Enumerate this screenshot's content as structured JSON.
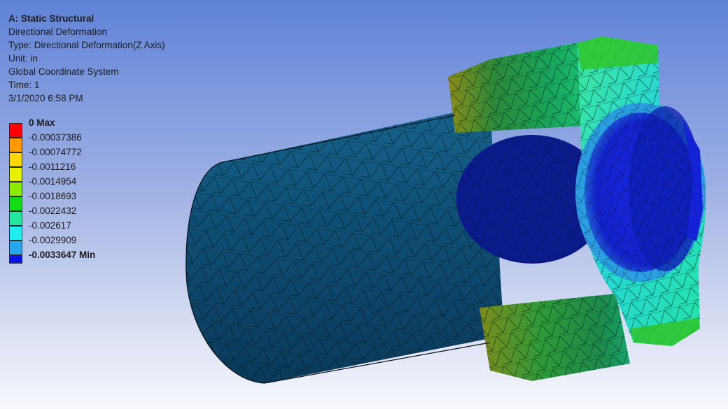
{
  "info": {
    "title": "A: Static Structural",
    "result_name": "Directional Deformation",
    "type": "Type: Directional Deformation(Z Axis)",
    "unit": "Unit: in",
    "coordinate_system": "Global Coordinate System",
    "time": "Time: 1",
    "date": "3/1/2020 6:58 PM"
  },
  "legend": {
    "entries": [
      {
        "label": "0 Max",
        "color": "#ff0000",
        "bold": true
      },
      {
        "label": "-0.00037386",
        "color": "#ff9900",
        "bold": false
      },
      {
        "label": "-0.00074772",
        "color": "#ffd800",
        "bold": false
      },
      {
        "label": "-0.0011216",
        "color": "#e6f000",
        "bold": false
      },
      {
        "label": "-0.0014954",
        "color": "#8cec00",
        "bold": false
      },
      {
        "label": "-0.0018693",
        "color": "#14dc14",
        "bold": false
      },
      {
        "label": "-0.0022432",
        "color": "#22e8a0",
        "bold": false
      },
      {
        "label": "-0.002617",
        "color": "#20eef0",
        "bold": false
      },
      {
        "label": "-0.0029909",
        "color": "#2aa6ec",
        "bold": false
      },
      {
        "label": "-0.0033647 Min",
        "color": "#0a14e8",
        "bold": true
      }
    ]
  },
  "model": {
    "body_color": "#0e4d74",
    "dark_blue": "#0b1a8c",
    "mid_blue": "#1422d6",
    "light_blue": "#2a9ee0",
    "cyan": "#24e0d8",
    "teal_green": "#1fc97d",
    "green": "#2cc12a",
    "olive": "#6f8a1c",
    "mesh_color": "#0a1a22"
  }
}
